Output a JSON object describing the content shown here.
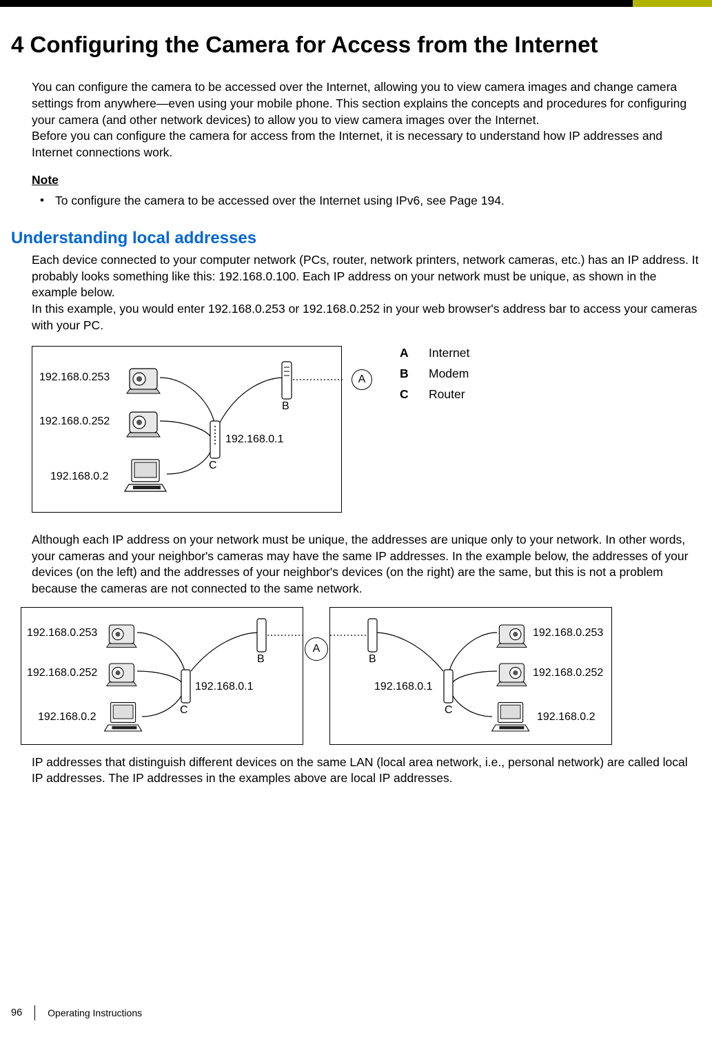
{
  "chapter_title": "4   Configuring the Camera for Access from the Internet",
  "intro_p1": "You can configure the camera to be accessed over the Internet, allowing you to view camera images and change camera settings from anywhere—even using your mobile phone. This section explains the concepts and procedures for configuring your camera (and other network devices) to allow you to view camera images over the Internet.",
  "intro_p2": "Before you can configure the camera for access from the Internet, it is necessary to understand how IP addresses and Internet connections work.",
  "note_label": "Note",
  "note_item": "To configure the camera to be accessed over the Internet using IPv6, see Page 194.",
  "section_title": "Understanding local addresses",
  "section_p1": "Each device connected to your computer network (PCs, router, network printers, network cameras, etc.) has an IP address. It probably looks something like this: 192.168.0.100. Each IP address on your network must be unique, as shown in the example below.",
  "section_p2": "In this example, you would enter 192.168.0.253 or 192.168.0.252 in your web browser's address bar to access your cameras with your PC.",
  "legend": {
    "a_key": "A",
    "a_val": "Internet",
    "b_key": "B",
    "b_val": "Modem",
    "c_key": "C",
    "c_val": "Router"
  },
  "diagram1": {
    "ip_cam1": "192.168.0.253",
    "ip_cam2": "192.168.0.252",
    "ip_pc": "192.168.0.2",
    "ip_router": "192.168.0.1",
    "a": "A",
    "b": "B",
    "c": "C"
  },
  "para_after_d1": "Although each IP address on your network must be unique, the addresses are unique only to your network. In other words, your cameras and your neighbor's cameras may have the same IP addresses. In the example below, the addresses of your devices (on the left) and the addresses of your neighbor's devices (on the right) are the same, but this is not a problem because the cameras are not connected to the same network.",
  "diagram2": {
    "left": {
      "ip_cam1": "192.168.0.253",
      "ip_cam2": "192.168.0.252",
      "ip_pc": "192.168.0.2",
      "ip_router": "192.168.0.1",
      "b": "B",
      "c": "C"
    },
    "center_a": "A",
    "right": {
      "ip_cam1": "192.168.0.253",
      "ip_cam2": "192.168.0.252",
      "ip_pc": "192.168.0.2",
      "ip_router": "192.168.0.1",
      "b": "B",
      "c": "C"
    }
  },
  "para_after_d2": "IP addresses that distinguish different devices on the same LAN (local area network, i.e., personal network) are called local IP addresses. The IP addresses in the examples above are local IP addresses.",
  "footer": {
    "page": "96",
    "doc": "Operating Instructions"
  }
}
